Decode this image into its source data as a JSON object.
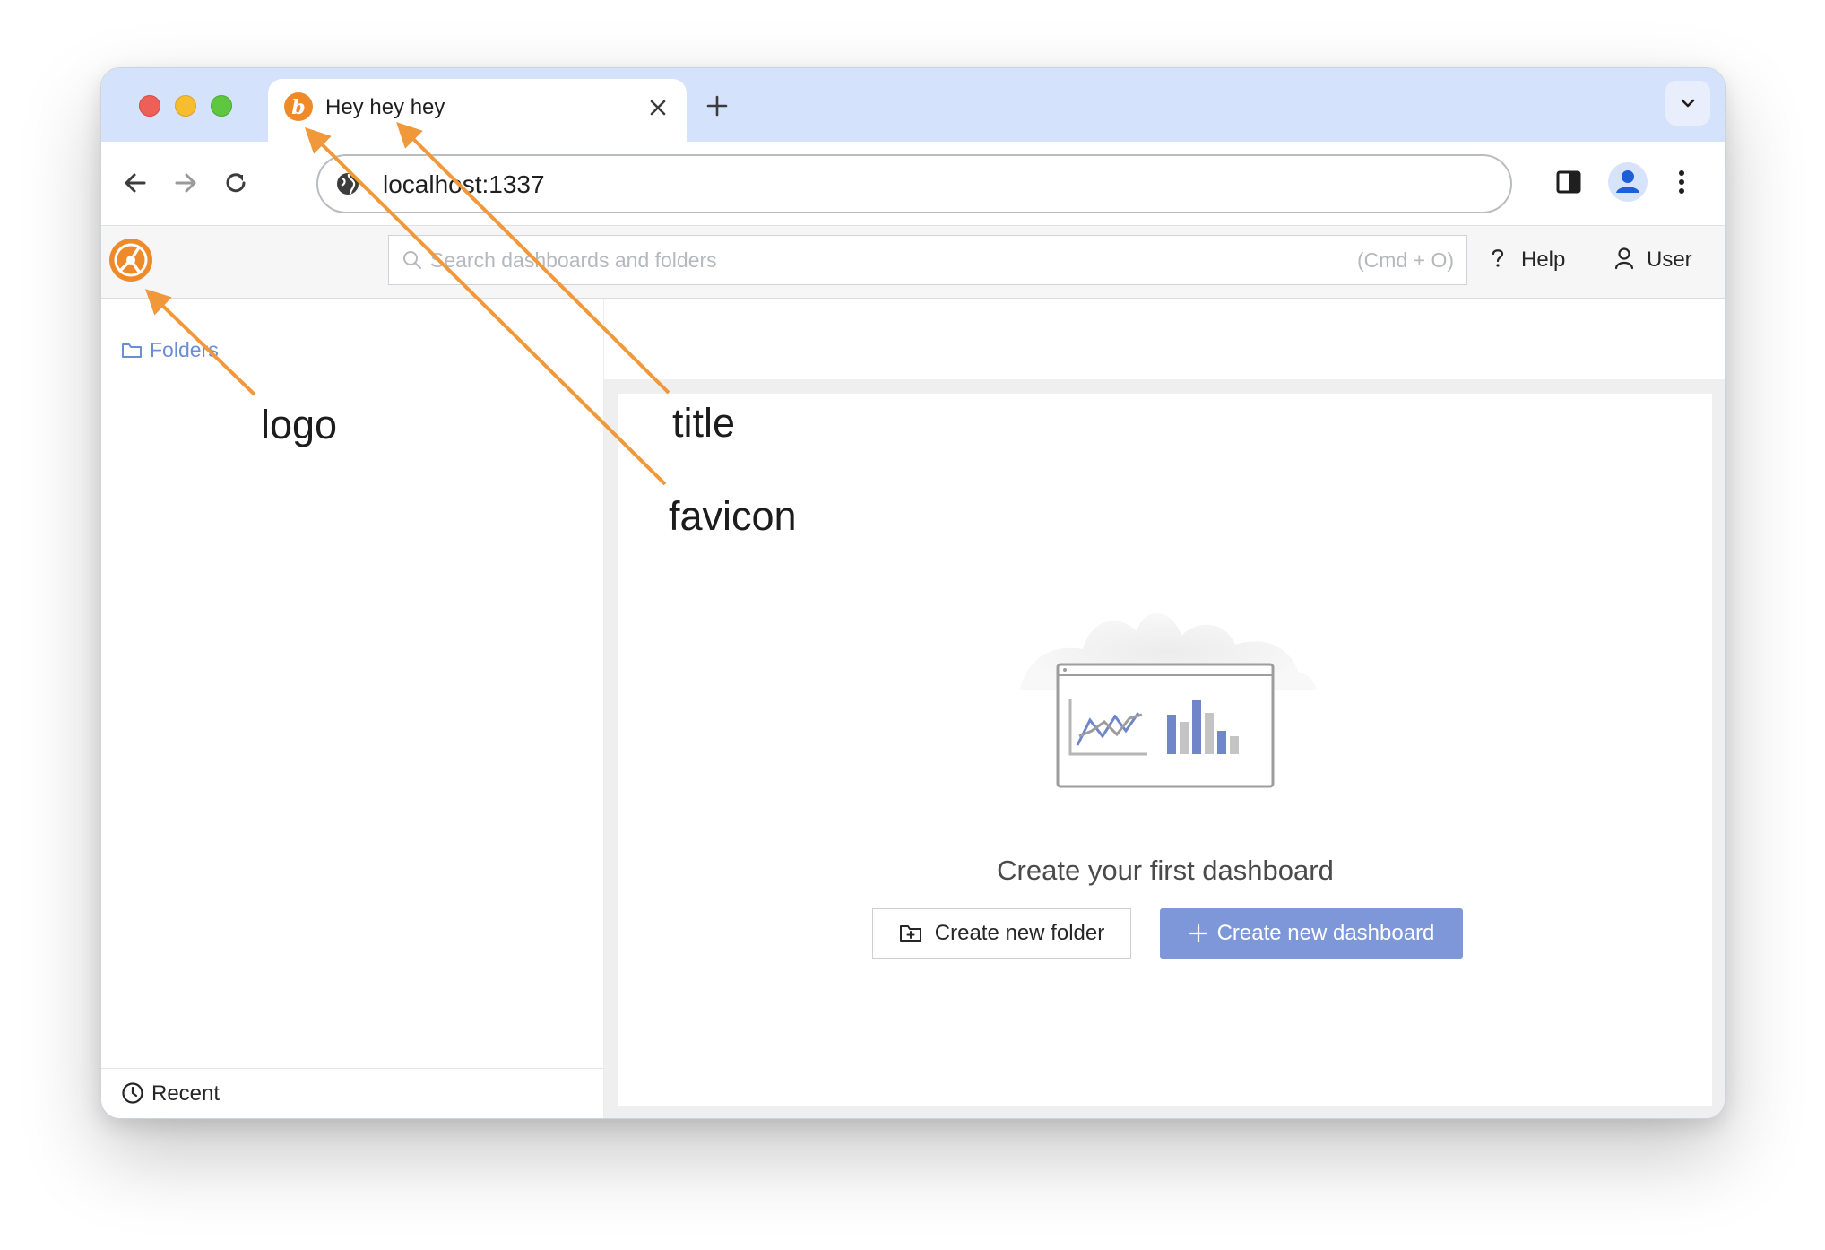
{
  "browser": {
    "tab": {
      "title": "Hey hey hey"
    },
    "address_bar": {
      "url": "localhost:1337"
    }
  },
  "app": {
    "search": {
      "placeholder": "Search dashboards and folders",
      "shortcut": "(Cmd + O)"
    },
    "header": {
      "help_label": "Help",
      "user_label": "User"
    },
    "sidebar": {
      "folders_label": "Folders",
      "recent_label": "Recent"
    },
    "empty_state": {
      "title": "Create your first dashboard",
      "create_folder_label": "Create new folder",
      "create_dashboard_label": "Create new dashboard"
    }
  },
  "annotations": {
    "logo": "logo",
    "title": "title",
    "favicon": "favicon",
    "color": "#f0983a"
  },
  "colors": {
    "accent": "#7d97d9",
    "brand": "#ef8a2a",
    "link": "#6a8fd0",
    "tabstrip": "#d4e2fb"
  }
}
